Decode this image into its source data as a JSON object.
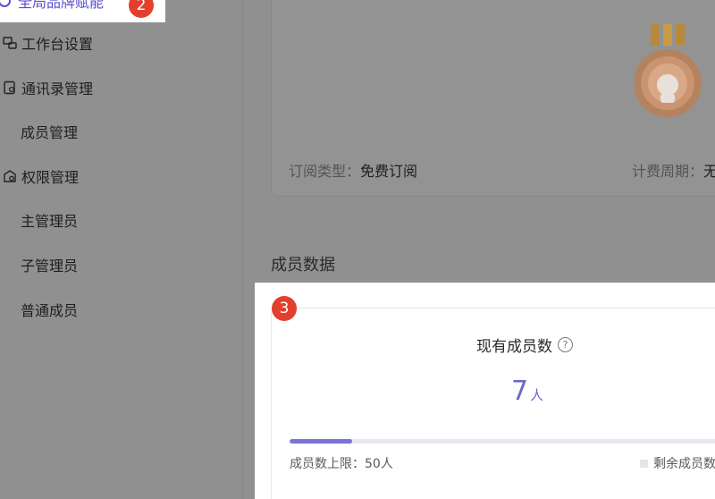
{
  "sidebar": {
    "top_item": "全局品牌赋能",
    "top_badge": "2",
    "items": [
      {
        "label": "工作台设置",
        "icon": "workbench-icon"
      },
      {
        "label": "通讯录管理",
        "icon": "contacts-icon"
      },
      {
        "label": "成员管理",
        "icon": ""
      },
      {
        "label": "权限管理",
        "icon": "permission-icon"
      },
      {
        "label": "主管理员",
        "icon": ""
      },
      {
        "label": "子管理员",
        "icon": ""
      },
      {
        "label": "普通成员",
        "icon": ""
      }
    ]
  },
  "subscription": {
    "type_label": "订阅类型：",
    "type_value": "免费订阅",
    "period_label": "计费周期：",
    "period_value": "无"
  },
  "members": {
    "section_title": "成员数据",
    "badge": "3",
    "title": "现有成员数",
    "count": "7",
    "unit": "人",
    "progress_fraction": 0.14,
    "limit_text": "成员数上限：50人",
    "remaining_text": "剩余成员数"
  },
  "colors": {
    "accent": "#5a4fcf",
    "badge": "#e2402c",
    "progress": "#7a73d6"
  }
}
